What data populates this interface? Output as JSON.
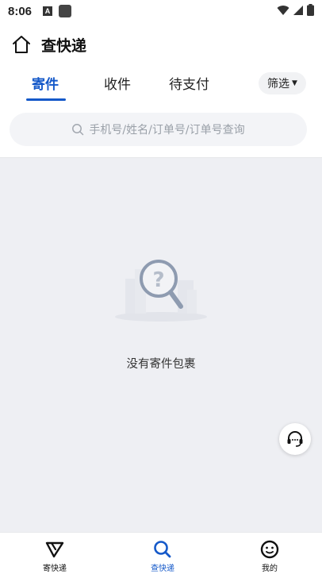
{
  "status_bar": {
    "time": "8:06",
    "notification_letter": "A"
  },
  "header": {
    "title": "查快递"
  },
  "tabs": [
    {
      "label": "寄件",
      "active": true
    },
    {
      "label": "收件",
      "active": false
    },
    {
      "label": "待支付",
      "active": false
    }
  ],
  "filter": {
    "label": "筛选"
  },
  "search": {
    "placeholder": "手机号/姓名/订单号/订单号查询"
  },
  "empty_state": {
    "text": "没有寄件包裹"
  },
  "bottom_nav": [
    {
      "label": "寄快递",
      "icon": "send-icon",
      "active": false
    },
    {
      "label": "查快递",
      "icon": "search-icon",
      "active": true
    },
    {
      "label": "我的",
      "icon": "smiley-icon",
      "active": false
    }
  ],
  "colors": {
    "accent": "#1559c9",
    "background": "#eeeff3"
  }
}
